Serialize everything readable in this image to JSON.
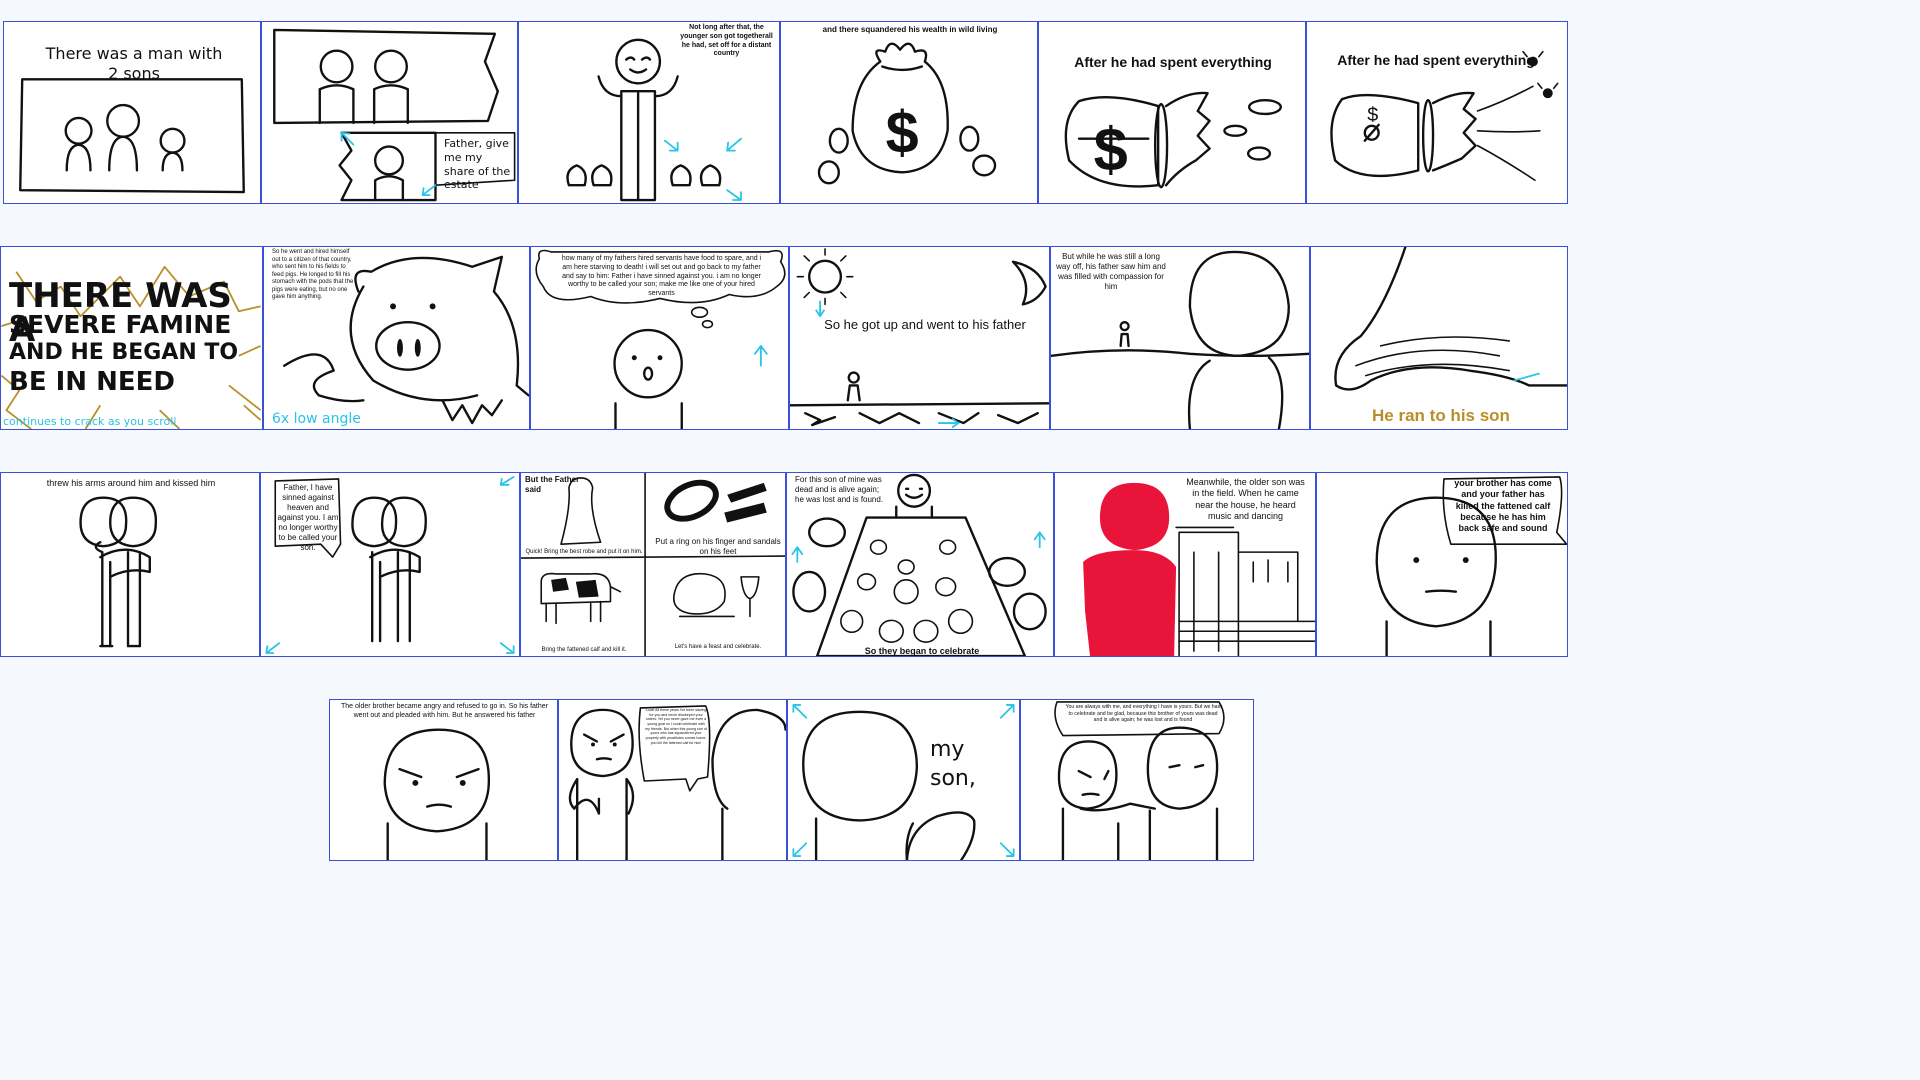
{
  "colors": {
    "border": "#3b4fd8",
    "cyan": "#29c4e6",
    "gold": "#b8902a",
    "red": "#e8143a",
    "ink": "#111111",
    "bg": "#f5f8fc"
  },
  "panels": {
    "p1": {
      "caption": "There was a man with 2 sons"
    },
    "p2": {
      "bubble": "Father, give me my share of the estate"
    },
    "p3": {
      "caption": "Not long after that, the younger son got togetherall he had, set off for a distant country"
    },
    "p4": {
      "caption": "and there squandered his wealth in wild living"
    },
    "p5": {
      "caption": "After he had spent everything"
    },
    "p6": {
      "caption": "After he had spent everything"
    },
    "p7": {
      "line1": "THERE WAS A",
      "line2": "SEVERE FAMINE",
      "line3": "AND HE BEGAN TO",
      "line4": "BE IN NEED",
      "note": "continues to crack as you scroll"
    },
    "p8": {
      "caption": "So he went and hired himself out to a citizen of that country, who sent him to his fields to feed pigs. He longed to fill his stomach with the pods that the pigs were eating, but no one gave him anything.",
      "note": "6x low angle"
    },
    "p9": {
      "caption": "how many of my fathers hired servants have food to spare, and i am here starving to death! i will set out and go back to my father and say to him: Father i have sinned against you. i am no longer worthy to be called your son; make me like one of your hired servants"
    },
    "p10": {
      "caption": "So he got up and went to his father"
    },
    "p11": {
      "caption": "But while he was still a long way off, his father saw him and was filled with compassion for him"
    },
    "p12": {
      "caption": "He ran to his son"
    },
    "p13": {
      "caption": "threw his arms around him and kissed him"
    },
    "p14": {
      "bubble": "Father, I have sinned against heaven and against you. I am no longer worthy to be called your son."
    },
    "p15": {
      "title": "But the Father said",
      "cap1": "Quick! Bring the best robe and put it on him.",
      "cap2": "Put a ring on his finger and sandals on his feet",
      "cap3": "Bring the fattened calf and kill it.",
      "cap4": "Let's have a feast and celebrate."
    },
    "p16": {
      "caption": "For this son of mine was dead and is alive again; he was lost and is found.",
      "bottom": "So they began to celebrate"
    },
    "p17": {
      "caption": "Meanwhile, the older son was in the field. When he came near the house, he heard music and dancing"
    },
    "p18": {
      "bubble": "your brother has come and your father  has killed the fattened calf because he has him back safe and sound"
    },
    "p19": {
      "caption": "The older brother became angry and refused to go in. So his father went out and pleaded with him. But he answered his father"
    },
    "p20": {
      "bubble": "Look! All these years I've been slaving for you and never disobeyed your orders. Yet you never gave me even a young goat so I could celebrate with my friends. But when this young son of yours who has squandered your property with prostitutes comes home, you kill the fattened calf for him!"
    },
    "p21": {
      "words": "my son,"
    },
    "p22": {
      "caption": "You are always with me, and everything I have is yours. But we had to celebrate and be glad, because this brother of yours was dead and is alive again; he was lost and is found"
    }
  }
}
